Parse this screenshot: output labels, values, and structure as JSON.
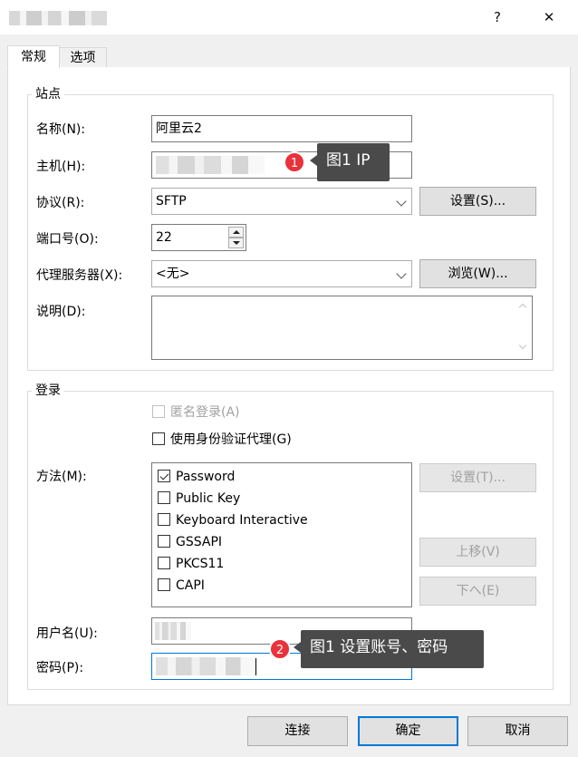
{
  "window": {
    "help_label": "?",
    "close_label": "✕"
  },
  "tabs": [
    {
      "label": "常规"
    },
    {
      "label": "选项"
    }
  ],
  "site": {
    "group_title": "站点",
    "name_label": "名称(N):",
    "name_value": "阿里云2",
    "host_label": "主机(H):",
    "protocol_label": "协议(R):",
    "protocol_value": "SFTP",
    "settings_button": "设置(S)...",
    "port_label": "端口号(O):",
    "port_value": "22",
    "proxy_label": "代理服务器(X):",
    "proxy_value": "<无>",
    "browse_button": "浏览(W)...",
    "desc_label": "说明(D):"
  },
  "login": {
    "group_title": "登录",
    "anonymous_label": "匿名登录(A)",
    "agent_label": "使用身份验证代理(G)",
    "method_label": "方法(M):",
    "methods": [
      {
        "label": "Password",
        "checked": true
      },
      {
        "label": "Public Key",
        "checked": false
      },
      {
        "label": "Keyboard Interactive",
        "checked": false
      },
      {
        "label": "GSSAPI",
        "checked": false
      },
      {
        "label": "PKCS11",
        "checked": false
      },
      {
        "label": "CAPI",
        "checked": false
      }
    ],
    "method_settings_button": "设置(T)...",
    "move_up_button": "上移(V)",
    "move_down_button": "下へ(E)",
    "username_label": "用户名(U):",
    "password_label": "密码(P):"
  },
  "footer": {
    "connect_button": "连接",
    "ok_button": "确定",
    "cancel_button": "取消"
  },
  "annotations": [
    {
      "number": "1",
      "text": "图1 IP"
    },
    {
      "number": "2",
      "text": "图1 设置账号、密码"
    }
  ]
}
